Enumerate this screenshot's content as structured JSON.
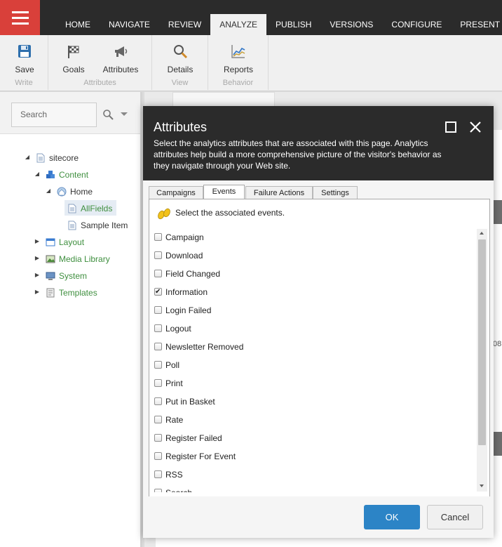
{
  "topnav": {
    "menu_icon": "hamburger-icon",
    "tabs": [
      "HOME",
      "NAVIGATE",
      "REVIEW",
      "ANALYZE",
      "PUBLISH",
      "VERSIONS",
      "CONFIGURE",
      "PRESENT"
    ],
    "active_tab": "ANALYZE"
  },
  "ribbon": {
    "groups": [
      {
        "label": "Write",
        "buttons": [
          {
            "label": "Save",
            "icon": "save-icon"
          }
        ]
      },
      {
        "label": "Attributes",
        "buttons": [
          {
            "label": "Goals",
            "icon": "flag-icon"
          },
          {
            "label": "Attributes",
            "icon": "megaphone-icon"
          }
        ]
      },
      {
        "label": "View",
        "buttons": [
          {
            "label": "Details",
            "icon": "magnifier-icon"
          }
        ]
      },
      {
        "label": "Behavior",
        "buttons": [
          {
            "label": "Reports",
            "icon": "chart-icon"
          }
        ]
      }
    ]
  },
  "search": {
    "placeholder": "Search"
  },
  "tree": [
    {
      "label": "sitecore",
      "icon": "document-icon"
    },
    {
      "label": "Content",
      "icon": "cubes-icon"
    },
    {
      "label": "Home",
      "icon": "home-icon"
    },
    {
      "label": "AllFields",
      "icon": "document-icon"
    },
    {
      "label": "Sample Item",
      "icon": "document-icon"
    },
    {
      "label": "Layout",
      "icon": "layout-icon"
    },
    {
      "label": "Media Library",
      "icon": "media-icon"
    },
    {
      "label": "System",
      "icon": "system-icon"
    },
    {
      "label": "Templates",
      "icon": "templates-icon"
    }
  ],
  "background": {
    "partial_text": "08"
  },
  "dialog": {
    "title": "Attributes",
    "description": "Select the analytics attributes that are associated with this page. Analytics attributes help build a more comprehensive picture of the visitor's behavior as they navigate through your Web site.",
    "tabs": [
      "Campaigns",
      "Events",
      "Failure Actions",
      "Settings"
    ],
    "active_tab": "Events",
    "panel_heading": "Select the associated events.",
    "events": [
      {
        "label": "Campaign",
        "checked": false
      },
      {
        "label": "Download",
        "checked": false
      },
      {
        "label": "Field Changed",
        "checked": false
      },
      {
        "label": "Information",
        "checked": true
      },
      {
        "label": "Login Failed",
        "checked": false
      },
      {
        "label": "Logout",
        "checked": false
      },
      {
        "label": "Newsletter Removed",
        "checked": false
      },
      {
        "label": "Poll",
        "checked": false
      },
      {
        "label": "Print",
        "checked": false
      },
      {
        "label": "Put in Basket",
        "checked": false
      },
      {
        "label": "Rate",
        "checked": false
      },
      {
        "label": "Register Failed",
        "checked": false
      },
      {
        "label": "Register For Event",
        "checked": false
      },
      {
        "label": "RSS",
        "checked": false
      },
      {
        "label": "Search",
        "checked": false
      }
    ],
    "ok_label": "OK",
    "cancel_label": "Cancel"
  },
  "colors": {
    "topbar": "#2b2b2b",
    "menu_button": "#d9403a",
    "tree_green": "#3f8f3f",
    "ok_button": "#2c84c6"
  }
}
